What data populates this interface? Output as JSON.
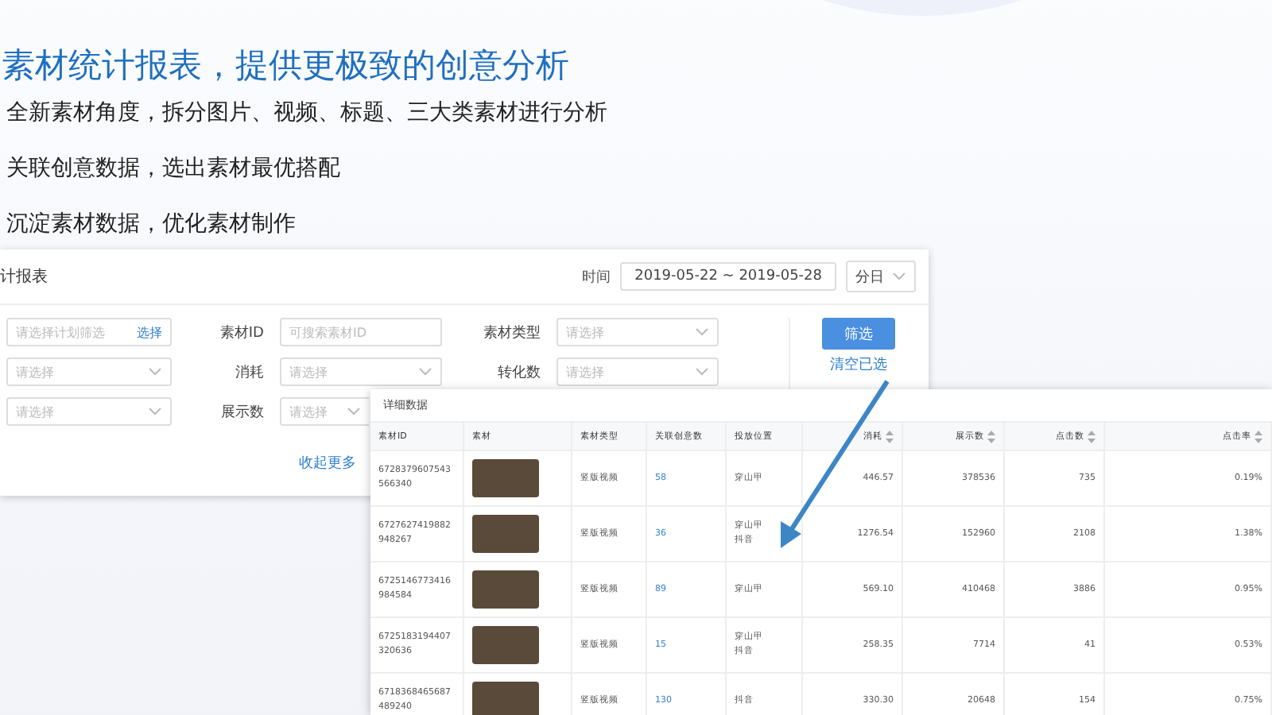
{
  "headline": "素材统计报表，提供更极致的创意分析",
  "points": [
    "全新素材角度，拆分图片、视频、标题、三大类素材进行分析",
    "关联创意数据，选出素材最优搭配",
    "沉淀素材数据，优化素材制作"
  ],
  "filter_panel": {
    "title": "计报表",
    "time_label": "时间",
    "date_range": "2019-05-22 ~ 2019-05-28",
    "granularity": "分日",
    "plan_field": {
      "placeholder": "请选择计划筛选",
      "link": "选择"
    },
    "left_selects": [
      {
        "placeholder": "请选择"
      },
      {
        "placeholder": "请选择"
      }
    ],
    "fields": [
      {
        "label": "素材ID",
        "kind": "input",
        "placeholder": "可搜索素材ID"
      },
      {
        "label": "消耗",
        "kind": "select",
        "placeholder": "请选择"
      },
      {
        "label": "展示数",
        "kind": "select",
        "placeholder": "请选择"
      }
    ],
    "fields_2": [
      {
        "label": "素材类型",
        "kind": "select",
        "placeholder": "请选择"
      },
      {
        "label": "转化数",
        "kind": "select",
        "placeholder": "请选择"
      }
    ],
    "filter_button": "筛选",
    "clear_link": "清空已选",
    "collapse_link": "收起更多"
  },
  "detail_table": {
    "title": "详细数据",
    "columns": [
      {
        "label": "素材ID",
        "sortable": false
      },
      {
        "label": "素材",
        "sortable": false
      },
      {
        "label": "素材类型",
        "sortable": false
      },
      {
        "label": "关联创意数",
        "sortable": false
      },
      {
        "label": "投放位置",
        "sortable": false
      },
      {
        "label": "消耗",
        "sortable": true
      },
      {
        "label": "展示数",
        "sortable": true
      },
      {
        "label": "点击数",
        "sortable": true
      },
      {
        "label": "点击率",
        "sortable": true
      }
    ],
    "rows": [
      {
        "id": "6728379607543566340",
        "type": "竖版视频",
        "creatives": "58",
        "placements": [
          "穿山甲"
        ],
        "cost": "446.57",
        "impressions": "378536",
        "clicks": "735",
        "ctr": "0.19%"
      },
      {
        "id": "6727627419882948267",
        "type": "竖版视频",
        "creatives": "36",
        "placements": [
          "穿山甲",
          "抖音"
        ],
        "cost": "1276.54",
        "impressions": "152960",
        "clicks": "2108",
        "ctr": "1.38%"
      },
      {
        "id": "6725146773416984584",
        "type": "竖版视频",
        "creatives": "89",
        "placements": [
          "穿山甲"
        ],
        "cost": "569.10",
        "impressions": "410468",
        "clicks": "3886",
        "ctr": "0.95%"
      },
      {
        "id": "6725183194407320636",
        "type": "竖版视频",
        "creatives": "15",
        "placements": [
          "穿山甲",
          "抖音"
        ],
        "cost": "258.35",
        "impressions": "7714",
        "clicks": "41",
        "ctr": "0.53%"
      },
      {
        "id": "6718368465687489240",
        "type": "竖版视频",
        "creatives": "130",
        "placements": [
          "抖音"
        ],
        "cost": "330.30",
        "impressions": "20648",
        "clicks": "154",
        "ctr": "0.75%"
      }
    ]
  }
}
